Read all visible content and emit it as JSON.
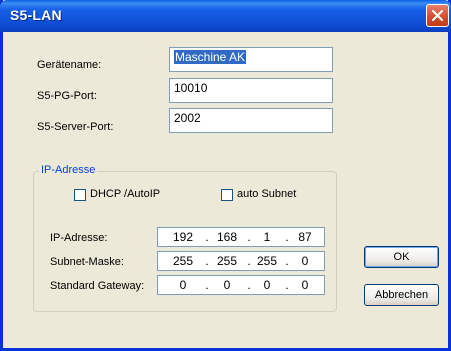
{
  "window": {
    "title": "S5-LAN"
  },
  "fields": {
    "geraetename": {
      "label": "Gerätename:",
      "value": "Maschine AK"
    },
    "pg_port": {
      "label": "S5-PG-Port:",
      "value": "10010"
    },
    "server_port": {
      "label": "S5-Server-Port:",
      "value": "2002"
    }
  },
  "ip_group": {
    "legend": "IP-Adresse",
    "dhcp_label": "DHCP /AutoIP",
    "dhcp_checked": false,
    "auto_subnet_label": "auto Subnet",
    "auto_subnet_checked": false,
    "ip_address": {
      "label": "IP-Adresse:",
      "octets": [
        "192",
        "168",
        "1",
        "87"
      ]
    },
    "subnet_mask": {
      "label": "Subnet-Maske:",
      "octets": [
        "255",
        "255",
        "255",
        "0"
      ]
    },
    "gateway": {
      "label": "Standard Gateway:",
      "octets": [
        "0",
        "0",
        "0",
        "0"
      ]
    }
  },
  "buttons": {
    "ok": "OK",
    "cancel": "Abbrechen"
  },
  "colors": {
    "titlebar": "#0a5fe8",
    "dialog_bg": "#ece9d8",
    "group_legend": "#0046d5",
    "selection": "#316ac5"
  },
  "icons": {
    "close": "close-icon"
  }
}
